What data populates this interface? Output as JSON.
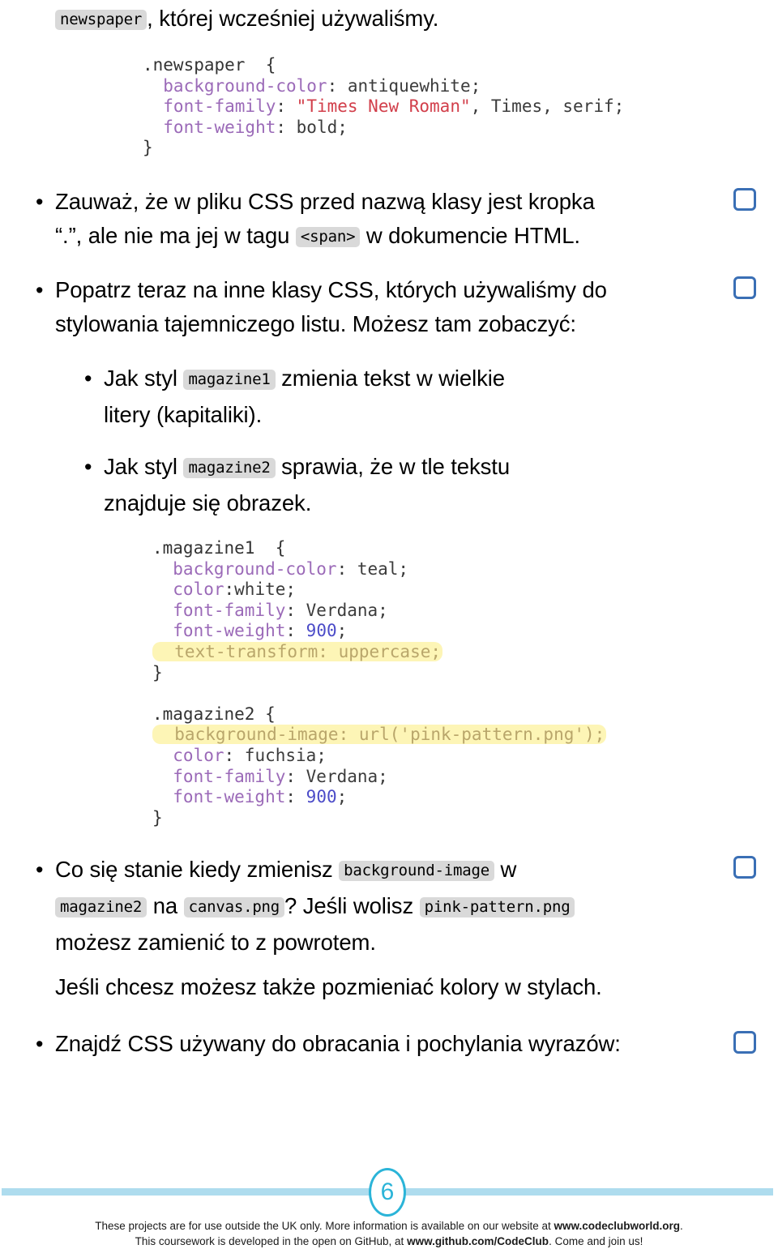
{
  "document": {
    "language": "pl",
    "page_number": "6",
    "lead_paragraph": {
      "code_chip": "newspaper",
      "text_after": ", której wcześniej używaliśmy."
    },
    "code_block_newspaper": {
      "lines": [
        {
          "parts": [
            {
              "t": ".newspaper  {",
              "c": "sel"
            }
          ]
        },
        {
          "parts": [
            {
              "t": "  background-color",
              "c": "prop"
            },
            {
              "t": ": antiquewhite;",
              "c": "val"
            }
          ]
        },
        {
          "parts": [
            {
              "t": "  font-family",
              "c": "prop"
            },
            {
              "t": ": ",
              "c": "val"
            },
            {
              "t": "\"Times New Roman\"",
              "c": "str"
            },
            {
              "t": ", Times, serif;",
              "c": "val"
            }
          ]
        },
        {
          "parts": [
            {
              "t": "  font-weight",
              "c": "prop"
            },
            {
              "t": ": bold;",
              "c": "val"
            }
          ]
        },
        {
          "parts": [
            {
              "t": "}",
              "c": "brace"
            }
          ]
        }
      ]
    },
    "code_block_magazine": {
      "lines": [
        {
          "parts": [
            {
              "t": ".magazine1  {",
              "c": "sel"
            }
          ]
        },
        {
          "parts": [
            {
              "t": "  background-color",
              "c": "prop"
            },
            {
              "t": ": teal;",
              "c": "val"
            }
          ]
        },
        {
          "parts": [
            {
              "t": "  color",
              "c": "prop"
            },
            {
              "t": ":white;",
              "c": "val"
            }
          ]
        },
        {
          "parts": [
            {
              "t": "  font-family",
              "c": "prop"
            },
            {
              "t": ": Verdana;",
              "c": "val"
            }
          ]
        },
        {
          "parts": [
            {
              "t": "  font-weight",
              "c": "prop"
            },
            {
              "t": ": ",
              "c": "val"
            },
            {
              "t": "900",
              "c": "num"
            },
            {
              "t": ";",
              "c": "val"
            }
          ]
        },
        {
          "highlight": true,
          "parts": [
            {
              "t": "  text-transform: uppercase;",
              "c": "val"
            }
          ]
        },
        {
          "parts": [
            {
              "t": "}",
              "c": "brace"
            }
          ]
        },
        {
          "blank": true
        },
        {
          "parts": [
            {
              "t": ".magazine2 {",
              "c": "sel"
            }
          ]
        },
        {
          "highlight": true,
          "parts": [
            {
              "t": "  background-image: url('pink-pattern.png');",
              "c": "val"
            }
          ]
        },
        {
          "parts": [
            {
              "t": "  color",
              "c": "prop"
            },
            {
              "t": ": fuchsia;",
              "c": "val"
            }
          ]
        },
        {
          "parts": [
            {
              "t": "  font-family",
              "c": "prop"
            },
            {
              "t": ": Verdana;",
              "c": "val"
            }
          ]
        },
        {
          "parts": [
            {
              "t": "  font-weight",
              "c": "prop"
            },
            {
              "t": ": ",
              "c": "val"
            },
            {
              "t": "900",
              "c": "num"
            },
            {
              "t": ";",
              "c": "val"
            }
          ]
        },
        {
          "parts": [
            {
              "t": "}",
              "c": "brace"
            }
          ]
        }
      ]
    },
    "bullets": {
      "b1_line1": "Zauważ, że w pliku CSS przed nazwą klasy jest kropka",
      "b1_line2_pre": "“.”, ale nie ma jej w tagu ",
      "b1_chip": "<span>",
      "b1_line2_post": " w dokumencie HTML.",
      "b2_line1": "Popatrz teraz na inne klasy CSS, których używaliśmy do",
      "b2_line2": "stylowania tajemniczego listu. Możesz tam zobaczyć:",
      "b3_pre": "Jak styl ",
      "b3_chip": "magazine1",
      "b3_post": " zmienia tekst w wielkie",
      "b3_line2": "litery (kapitaliki).",
      "b4_pre": "Jak styl ",
      "b4_chip": "magazine2",
      "b4_post": " sprawia, że w tle tekstu",
      "b4_line2": "znajduje się obrazek.",
      "b5_pre": "Co się stanie kiedy zmienisz ",
      "b5_chip1": "background-image",
      "b5_mid1": " w",
      "b5_chip2": "magazine2",
      "b5_mid2": " na ",
      "b5_chip3": "canvas.png",
      "b5_mid3": "? Jeśli wolisz ",
      "b5_chip4": "pink-pattern.png",
      "b5_line3": "możesz zamienić to z powrotem.",
      "b5_line4": "Jeśli chcesz możesz także pozmieniać kolory w stylach.",
      "b6_text": "Znajdź CSS używany do obracania i pochylania wyrazów:"
    },
    "footer": {
      "line1_a": "These projects are for use outside the UK only. More information is available on our website at ",
      "line1_b": "www.codeclubworld.org",
      "line1_c": ".",
      "line2_a": "This coursework is developed in the open on GitHub, at ",
      "line2_b": "www.github.com/CodeClub",
      "line2_c": ". Come and join us!"
    },
    "colors": {
      "checkbox_border": "#3a6fb5",
      "footer_rule": "#aedcee",
      "page_badge": "#2bb4d8",
      "chip_background": "#d9d9d9",
      "code_property": "#9b6ab8",
      "code_string": "#d23f4b",
      "code_number": "#4b4bc8",
      "code_highlight": "#fdf5b6"
    }
  }
}
